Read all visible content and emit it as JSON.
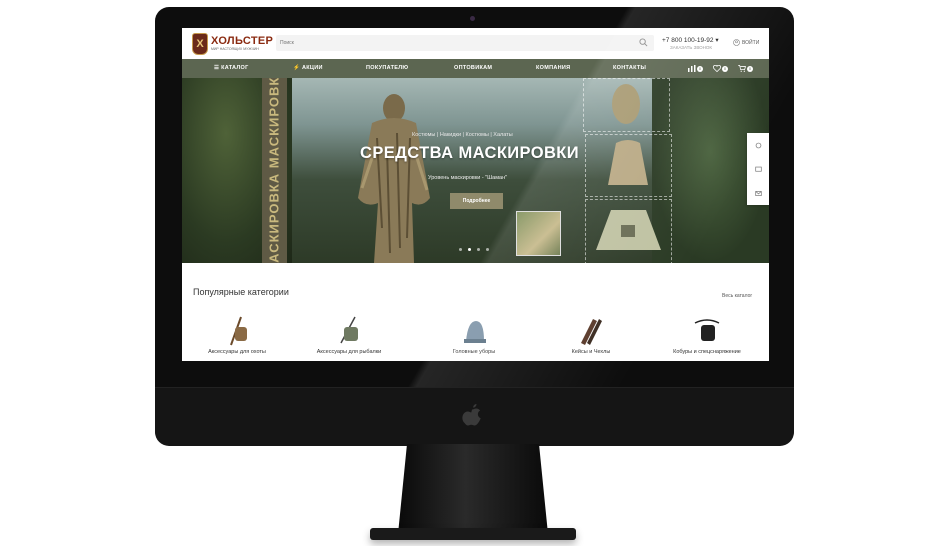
{
  "header": {
    "logo_letter": "Х",
    "logo_title": "ХОЛЬСТЕР",
    "logo_subtitle": "МИР НАСТОЯЩИХ МУЖЧИН",
    "search_placeholder": "Поиск",
    "phone": "+7 800 100-19-92",
    "phone_arrow": "▾",
    "callback": "ЗАКАЗАТЬ ЗВОНОК",
    "login": "ВОЙТИ"
  },
  "nav": {
    "items": [
      "КАТАЛОГ",
      "АКЦИИ",
      "ПОКУПАТЕЛЮ",
      "ОПТОВИКАМ",
      "КОМПАНИЯ",
      "КОНТАКТЫ"
    ],
    "catalog_icon": "☰",
    "sale_icon": "⚡",
    "compare_count": "0",
    "favorites_count": "0",
    "cart_count": "0"
  },
  "banner": {
    "vertical_text": "МАСКИРОВКА МАСКИРОВКА",
    "breadcrumbs": "Костюмы | Накидки | Костюмы | Халаты",
    "title": "СРЕДСТВА МАСКИРОВКИ",
    "subtitle": "Уровень маскировки - \"Шаман\"",
    "button": "Подробнее",
    "slides": 4,
    "active_slide": 2
  },
  "popular": {
    "title": "Популярные категории",
    "all_link": "Весь каталог",
    "categories": [
      {
        "label": "Аксессуары для охоты",
        "icon": "hunting-gear-icon"
      },
      {
        "label": "Аксессуары для рыбалки",
        "icon": "fishing-gear-icon"
      },
      {
        "label": "Головные уборы",
        "icon": "headwear-icon"
      },
      {
        "label": "Кейсы и Чехлы",
        "icon": "gun-case-icon"
      },
      {
        "label": "Кобуры и спецснаряжение",
        "icon": "holster-icon"
      }
    ]
  },
  "colors": {
    "nav_bg": "#5c6651",
    "brand": "#8a2a10",
    "button_bg": "#8f8a6b"
  }
}
